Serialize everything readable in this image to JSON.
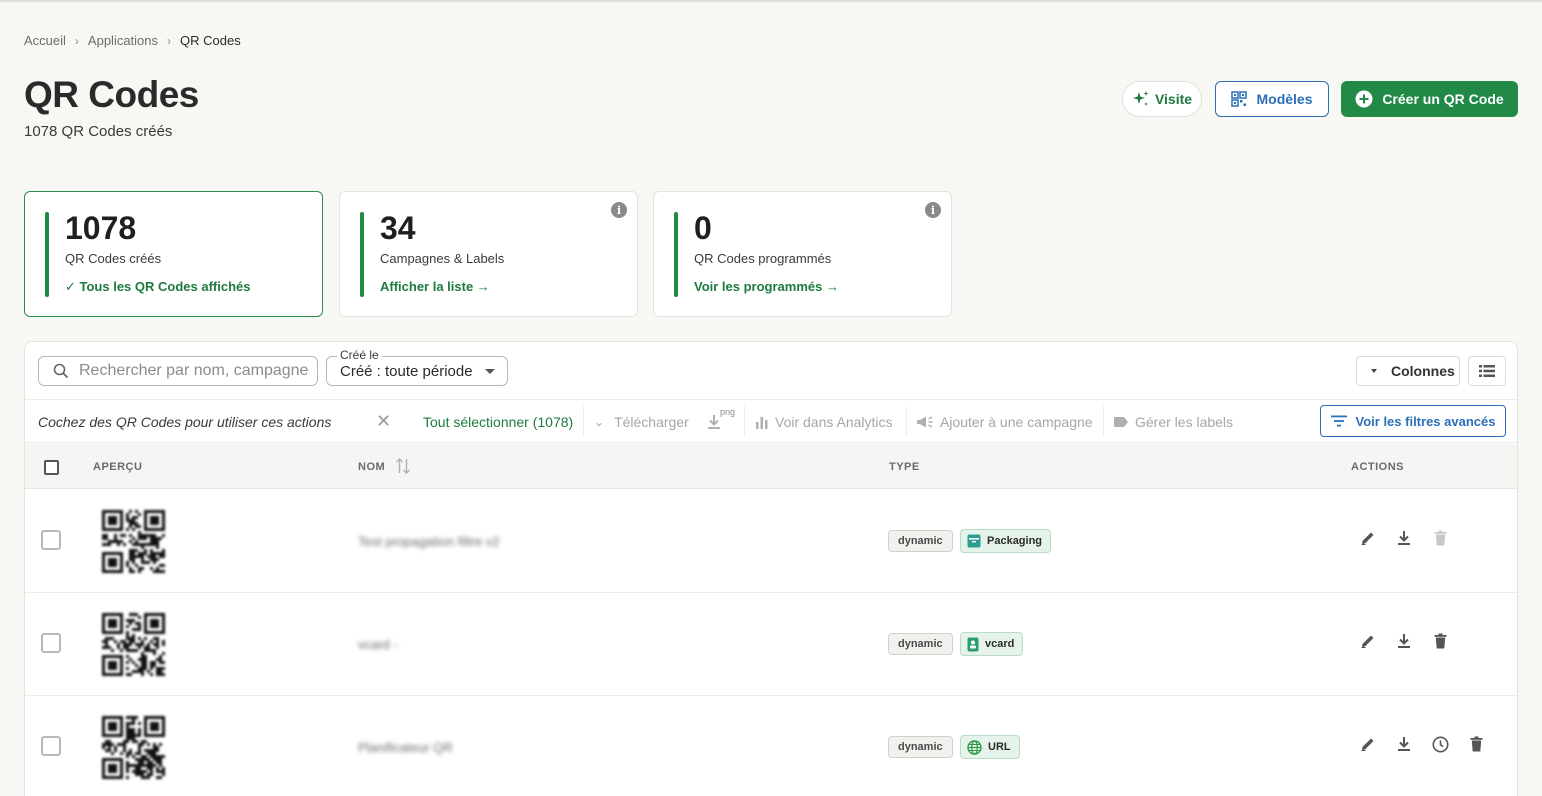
{
  "breadcrumb": {
    "items": [
      "Accueil",
      "Applications",
      "QR Codes"
    ]
  },
  "page": {
    "title": "QR Codes",
    "subtitle": "1078 QR Codes créés"
  },
  "header_buttons": {
    "visite": "Visite",
    "modeles": "Modèles",
    "create": "Créer un QR Code"
  },
  "stats": [
    {
      "value": "1078",
      "label": "QR Codes créés",
      "link": "✓ Tous les QR Codes affichés"
    },
    {
      "value": "34",
      "label": "Campagnes & Labels",
      "link": "Afficher la liste →"
    },
    {
      "value": "0",
      "label": "QR Codes programmés",
      "link": "Voir les programmés →"
    }
  ],
  "toolbar": {
    "search_placeholder": "Rechercher par nom, campagne",
    "date_float_label": "Créé le",
    "date_value": "Créé : toute période",
    "columns_label": "Colonnes"
  },
  "bulk_actions": {
    "hint": "Cochez des QR Codes pour utiliser ces actions",
    "select_all": "Tout sélectionner (1078)",
    "download": "Télécharger",
    "png": "png",
    "analytics": "Voir dans Analytics",
    "add_campaign": "Ajouter à une campagne",
    "labels": "Gérer les labels",
    "advanced_filters": "Voir les filtres avancés"
  },
  "table": {
    "headers": {
      "preview": "APERÇU",
      "name": "NOM",
      "type": "TYPE",
      "actions": "ACTIONS"
    },
    "rows": [
      {
        "name": "Test propagation filtre v2",
        "mode": "dynamic",
        "type": "Packaging",
        "type_icon": "package-icon",
        "has_schedule": false,
        "delete_enabled": false
      },
      {
        "name": "vcard -",
        "mode": "dynamic",
        "type": "vcard",
        "type_icon": "contact-card-icon",
        "has_schedule": false,
        "delete_enabled": true
      },
      {
        "name": "Planificateur QR",
        "mode": "dynamic",
        "type": "URL",
        "type_icon": "globe-icon",
        "has_schedule": true,
        "delete_enabled": true
      }
    ]
  },
  "colors": {
    "brand_green": "#208a46",
    "link_blue": "#2a6fb8",
    "type_pill_bg": "#e6f3ea"
  }
}
